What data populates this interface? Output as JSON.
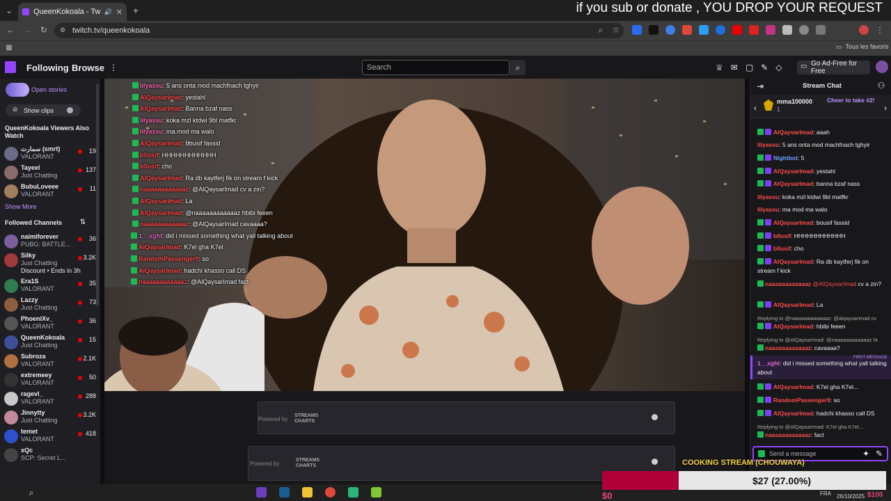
{
  "browser": {
    "tab_title": "QueenKokoala - Twitch",
    "overlay_text": "if you sub or donate , YOU DROP YOUR REQUEST",
    "url": "twitch.tv/queenkokoala",
    "bookmarks_label": "Tous les favoris"
  },
  "twitch": {
    "nav": {
      "following": "Following",
      "browse": "Browse",
      "search_placeholder": "Search",
      "ad_free": "Go Ad-Free for Free"
    },
    "sidebar": {
      "open_stories": "Open stories",
      "show_clips": "Show clips",
      "also_watch_title": "QueenKokoala Viewers Also Watch",
      "also_watch": [
        {
          "name": "سمارت (smrt)",
          "game": "VALORANT",
          "viewers": "19",
          "color": "#6b6b8a"
        },
        {
          "name": "Tayeel",
          "game": "Just Chatting",
          "viewers": "137",
          "color": "#8a6b6b"
        },
        {
          "name": "BubuLoveee",
          "game": "VALORANT",
          "viewers": "11",
          "color": "#a08060"
        }
      ],
      "show_more": "Show More",
      "followed_title": "Followed Channels",
      "followed": [
        {
          "name": "naimiforever",
          "game": "PUBG: BATTLE...",
          "viewers": "36",
          "color": "#7d5fa0"
        },
        {
          "name": "Silky",
          "game": "Just Chatting",
          "viewers": "3.2K",
          "color": "#a03a3a",
          "extra": "Discount • Ends in 3h"
        },
        {
          "name": "Era1S",
          "game": "VALORANT",
          "viewers": "35",
          "color": "#2f7d4f"
        },
        {
          "name": "Lazzy",
          "game": "Just Chatting",
          "viewers": "73",
          "color": "#8a5e3f"
        },
        {
          "name": "PhoeniXv_",
          "game": "VALORANT",
          "viewers": "36",
          "color": "#555"
        },
        {
          "name": "QueenKokoala",
          "game": "Just Chatting",
          "viewers": "15",
          "color": "#3f4f9a"
        },
        {
          "name": "Subroza",
          "game": "VALORANT",
          "viewers": "2.1K",
          "color": "#b07040"
        },
        {
          "name": "extremeey",
          "game": "VALORANT",
          "viewers": "50",
          "color": "#333"
        },
        {
          "name": "ragevl_",
          "game": "VALORANT",
          "viewers": "288",
          "color": "#c8c8c8"
        },
        {
          "name": "Jinnytty",
          "game": "Just Chatting",
          "viewers": "3.2K",
          "color": "#c08a9a"
        },
        {
          "name": "temet",
          "game": "VALORANT",
          "viewers": "418",
          "color": "#2d4fd0"
        },
        {
          "name": "xQc",
          "game": "SCP: Secret L...",
          "viewers": "",
          "color": "#444"
        }
      ]
    },
    "stream_overlay_chat": [
      {
        "user": "lilyassu",
        "msg": ": 5 ans onta mod machfnach tghyir",
        "c": "#ff6bb5"
      },
      {
        "user": "AlQaysarImad",
        "msg": ": yestahl",
        "c": "#ff4b4b"
      },
      {
        "user": "AlQaysarImad",
        "msg": ": Banna bzaf nass",
        "c": "#ff4b4b"
      },
      {
        "user": "lilyassu",
        "msg": ": koka mzl ktdwi 9bl matfkr",
        "c": "#ff6bb5"
      },
      {
        "user": "lilyassu",
        "msg": ": ma.mod ma walo",
        "c": "#ff6bb5"
      },
      {
        "user": "AlQaysarImad",
        "msg": ": bousif fassid",
        "c": "#ff4b4b"
      },
      {
        "user": "b0usif",
        "msg": ": HHHHHHHHHHHH",
        "c": "#ff4b4b"
      },
      {
        "user": "b0usif",
        "msg": ": cho",
        "c": "#ff4b4b"
      },
      {
        "user": "AlQaysarImad",
        "msg": ": Ra db kaytferj fik on stream f kick",
        "c": "#ff4b4b"
      },
      {
        "user": "naaaaaaaaaaaaz",
        "msg": ": @AlQaysarImad cv a zin?",
        "c": "#ff4b4b"
      },
      {
        "user": "AlQaysarImad",
        "msg": ": La",
        "c": "#ff4b4b"
      },
      {
        "user": "AlQaysarImad",
        "msg": ": @naaaaaaaaaaaaz hbibi feeen",
        "c": "#ff4b4b"
      },
      {
        "user": "naaaaaaaaaaaaz",
        "msg": ": @AlQaysarImad cavaaaa?",
        "c": "#ff4b4b"
      },
      {
        "user": "1__xght",
        "msg": ": did i missed something what yall talking about",
        "c": "#e06bd0"
      },
      {
        "user": "AlQaysarImad",
        "msg": ": K7el gha K7el.",
        "c": "#ff4b4b"
      },
      {
        "user": "RandomPassenger9",
        "msg": ": so",
        "c": "#ff4b4b"
      },
      {
        "user": "AlQaysarImad",
        "msg": ": hadchi khasso call DS",
        "c": "#ff4b4b"
      },
      {
        "user": "naaaaaaaaaaaaz",
        "msg": ": @AlQaysarImad fact",
        "c": "#ff4b4b"
      }
    ],
    "panels": {
      "powered_by": "Powered by",
      "streams_charts": "STREAMS CHARTS"
    },
    "chat": {
      "title": "Stream Chat",
      "pinned_user": "mma100000",
      "pinned_count": "1",
      "cheer_text": "Cheer to take #2!",
      "first_message_tag": "FIRST MESSAGE",
      "send_placeholder": "Send a message",
      "messages": [
        {
          "user": "AlQaysarImad",
          "text": ": aaah",
          "cls": "red",
          "badge": true
        },
        {
          "user": "lilyassu",
          "text": ": 5 ans onta mod machfnach tghyir",
          "cls": "red",
          "badge": false
        },
        {
          "user": "Nightbot",
          "text": ": 5",
          "cls": "blue",
          "badge": true
        },
        {
          "user": "AlQaysarImad",
          "text": ": yestahl",
          "cls": "red",
          "badge": true
        },
        {
          "user": "AlQaysarImad",
          "text": ": banna bzaf nass",
          "cls": "red",
          "badge": true
        },
        {
          "user": "lilyassu",
          "text": ": koka mzl ktdwi 9bl matfkr",
          "cls": "red",
          "badge": false
        },
        {
          "user": "lilyassu",
          "text": ": ma mod ma walo",
          "cls": "red",
          "badge": false
        },
        {
          "user": "AlQaysarImad",
          "text": ": bousif fassid",
          "cls": "red",
          "badge": true
        },
        {
          "user": "b0usif",
          "text": ": HHHHHHHHHHHH",
          "cls": "red",
          "badge": true
        },
        {
          "user": "b0usif",
          "text": ": cho",
          "cls": "red",
          "badge": true
        }
      ],
      "msg_ra": {
        "user": "AlQaysarImad",
        "text": ": Ra db kaytferj fik on stream f kick"
      },
      "msg_cv": {
        "user": "naaaaaaaaaaaaz",
        "mention": "@AlQaysarImad",
        "text": " cv a zin?"
      },
      "msg_la": {
        "user": "AlQaysarImad",
        "text": ": La"
      },
      "reply1": "Replying to @naaaaaaaaaaaaz: @alqaysarimad cv",
      "msg_hb": {
        "user": "AlQaysarImad",
        "text": ": hbibi feeen"
      },
      "reply2": "Replying to @AlQaysarImad: @naaaaaaaaaaaaz ht",
      "msg_ca": {
        "user": "naaaaaaaaaaaaz",
        "text": ": cavaaaa?"
      },
      "msg_first": {
        "user": "1__xght",
        "text": ": did i missed something what yall talking about"
      },
      "msg_k7": {
        "user": "AlQaysarImad",
        "text": ": K7el gha K7el..."
      },
      "msg_so": {
        "user": "RandomPassenger9",
        "text": ": so"
      },
      "msg_ds": {
        "user": "AlQaysarImad",
        "text": ": hadchi khasso call DS"
      },
      "reply3": "Replying to @AlQaysarImad: K7el gha K7el...",
      "msg_fact": {
        "user": "naaaaaaaaaaaaz",
        "text": ": fact"
      }
    }
  },
  "donation_goal": {
    "title": "COOKING STREAM (CHOUWAYA)",
    "amount": "$27 (27.00%)",
    "start": "$0",
    "progress": 0.27
  },
  "taskbar": {
    "lang": "FRA",
    "date": "26/10/2025",
    "right_amount": "$100"
  }
}
